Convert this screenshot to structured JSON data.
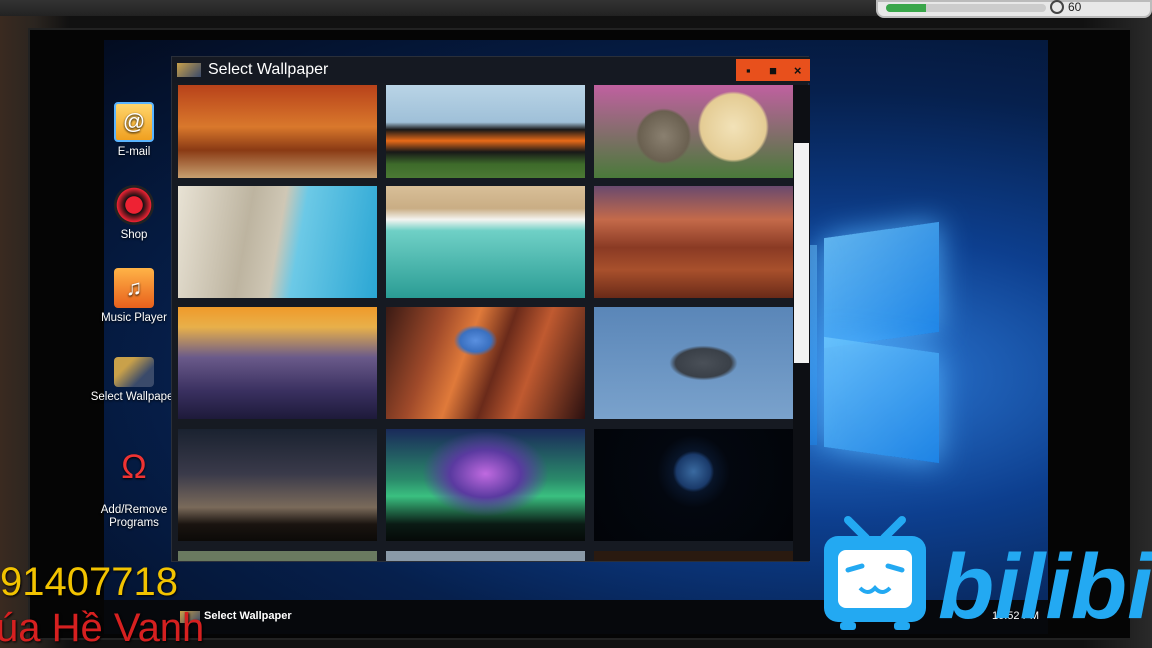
{
  "hud": {
    "progress": 0.25,
    "value": "60"
  },
  "desktop_icons": [
    {
      "label": "E-mail",
      "icon": "email-icon"
    },
    {
      "label": "Shop",
      "icon": "shop-icon"
    },
    {
      "label": "Music Player",
      "icon": "music-player-icon"
    },
    {
      "label": "Select Wallpaper",
      "icon": "select-wallpaper-icon"
    },
    {
      "label": "Add/Remove\nPrograms",
      "icon": "add-remove-programs-icon"
    }
  ],
  "window": {
    "title": "Select Wallpaper",
    "controls": {
      "minimize": "▪",
      "maximize": "■",
      "close": "×"
    },
    "wallpapers": [
      {
        "name": "autumn-forest"
      },
      {
        "name": "hot-rod-car"
      },
      {
        "name": "kitten-puppy"
      },
      {
        "name": "sea-cave"
      },
      {
        "name": "beach-aerial"
      },
      {
        "name": "desert-canyon"
      },
      {
        "name": "misty-mountains"
      },
      {
        "name": "antelope-canyon"
      },
      {
        "name": "fighter-jet"
      },
      {
        "name": "milky-way"
      },
      {
        "name": "aurora"
      },
      {
        "name": "planet-earth"
      }
    ]
  },
  "taskbar": {
    "active_window_label": "Select Wallpaper",
    "clock": "10:52 PM"
  },
  "overlay": {
    "line1": "91407718",
    "line2": "úa Hề Vanh"
  },
  "watermark": {
    "text": "bilibili"
  },
  "colors": {
    "accent": "#e8501c",
    "overlay_yellow": "#f2c300",
    "overlay_red": "#d62020",
    "bili_blue": "#23a9f2"
  }
}
